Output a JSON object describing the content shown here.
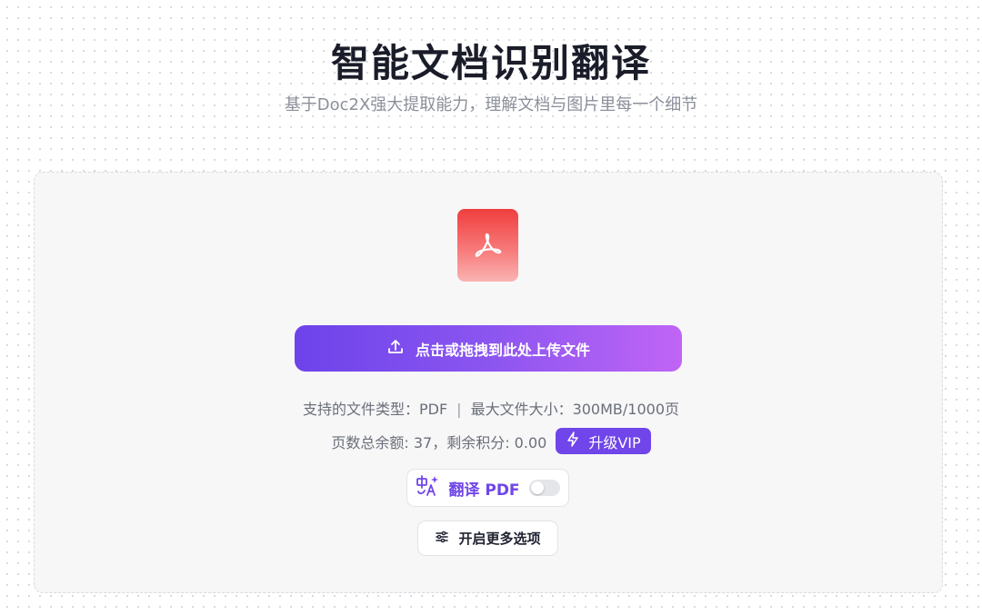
{
  "header": {
    "title": "智能文档识别翻译",
    "subtitle": "基于Doc2X强大提取能力，理解文档与图片里每一个细节"
  },
  "upload": {
    "file_icon": "pdf-file-icon",
    "button_label": "点击或拖拽到此处上传文件",
    "button_icon": "upload-icon",
    "supported_types": "支持的文件类型：PDF",
    "separator": "|",
    "max_size": "最大文件大小：300MB/1000页"
  },
  "quota": {
    "text": "页数总余额: 37，剩余积分: 0.00",
    "vip_label": "升级VIP",
    "vip_icon": "lightning-icon"
  },
  "translate": {
    "icon": "translate-icon",
    "label": "翻译 PDF",
    "enabled": false
  },
  "more_options": {
    "icon": "sliders-icon",
    "label": "开启更多选项"
  },
  "colors": {
    "accent": "#7045ea",
    "gradient_start": "#6d43ea",
    "gradient_end": "#c065f5",
    "pdf_red": "#f03e3e"
  }
}
